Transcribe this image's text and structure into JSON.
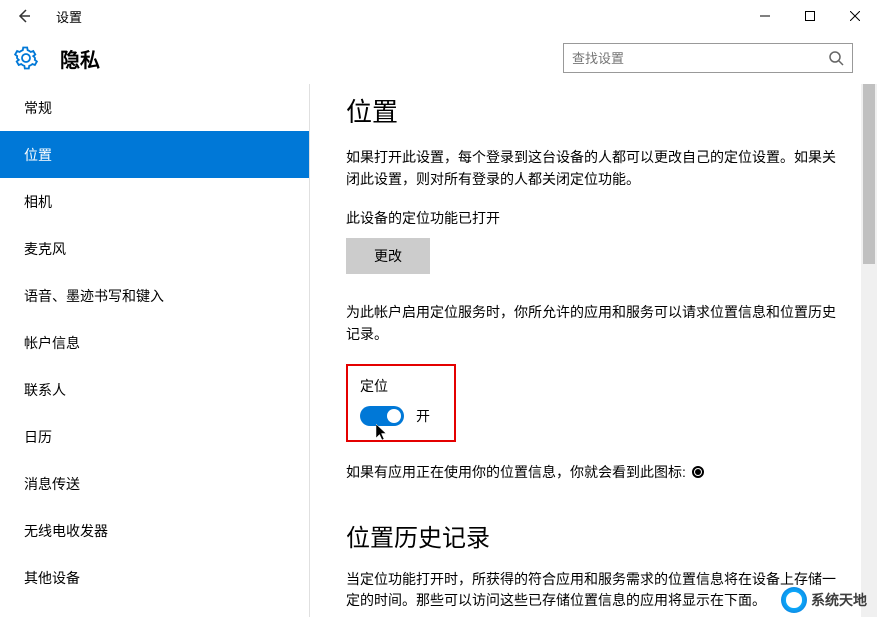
{
  "titlebar": {
    "title": "设置"
  },
  "header": {
    "page_title": "隐私",
    "search_placeholder": "查找设置"
  },
  "sidebar": {
    "items": [
      {
        "label": "常规",
        "selected": false
      },
      {
        "label": "位置",
        "selected": true
      },
      {
        "label": "相机",
        "selected": false
      },
      {
        "label": "麦克风",
        "selected": false
      },
      {
        "label": "语音、墨迹书写和键入",
        "selected": false
      },
      {
        "label": "帐户信息",
        "selected": false
      },
      {
        "label": "联系人",
        "selected": false
      },
      {
        "label": "日历",
        "selected": false
      },
      {
        "label": "消息传送",
        "selected": false
      },
      {
        "label": "无线电收发器",
        "selected": false
      },
      {
        "label": "其他设备",
        "selected": false
      }
    ]
  },
  "content": {
    "heading1": "位置",
    "intro": "如果打开此设置，每个登录到这台设备的人都可以更改自己的定位设置。如果关闭此设置，则对所有登录的人都关闭定位功能。",
    "device_status": "此设备的定位功能已打开",
    "change_button": "更改",
    "account_desc": "为此帐户启用定位服务时，你所允许的应用和服务可以请求位置信息和位置历史记录。",
    "toggle_title": "定位",
    "toggle_state": "开",
    "indicator_line": "如果有应用正在使用你的位置信息，你就会看到此图标:",
    "heading2": "位置历史记录",
    "history_desc": "当定位功能打开时，所获得的符合应用和服务需求的位置信息将在设备上存储一定的时间。那些可以访问这些已存储位置信息的应用将显示在下面。"
  },
  "watermark": {
    "text": "系统天地"
  }
}
